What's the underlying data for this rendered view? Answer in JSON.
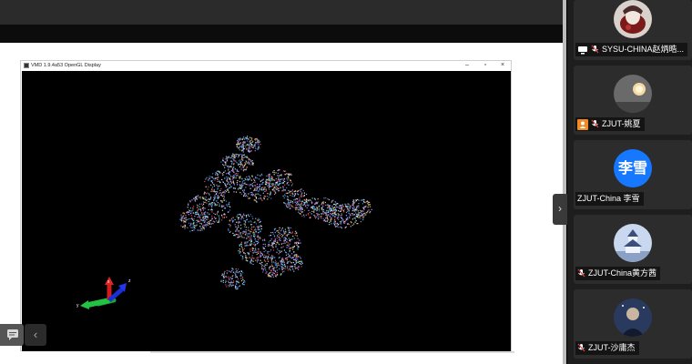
{
  "vmd_window": {
    "title": "VMD 1.9.4a53 OpenGL Display",
    "axes": {
      "x": "x",
      "y": "y",
      "z": "z"
    }
  },
  "left_toolbar": {
    "chat_icon": "chat-bubble-icon",
    "collapse_icon": "chevron-left-icon",
    "collapse_glyph": "‹"
  },
  "panel_toggle": {
    "glyph": "›"
  },
  "participants": [
    {
      "name": "SYSU-CHINA赵炳晧...",
      "avatar": "photo",
      "muted": true,
      "flag": "screen-share-icon"
    },
    {
      "name": "ZJUT-姚夏",
      "avatar": "photo",
      "muted": true,
      "flag": "person-icon"
    },
    {
      "name": "ZJUT-China 李雪",
      "avatar_text": "李雪",
      "avatar_color": "#1677ff",
      "muted": false
    },
    {
      "name": "ZJUT-China黄方茜",
      "avatar": "photo",
      "muted": true
    },
    {
      "name": "ZJUT-沙庸杰",
      "avatar": "photo",
      "muted": true
    }
  ],
  "colors": {
    "accent_blue": "#1677ff",
    "flag_orange": "#f08a24",
    "mic_muted": "#e03e3e"
  }
}
